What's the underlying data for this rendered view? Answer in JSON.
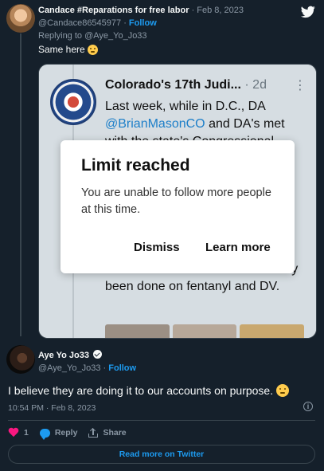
{
  "reply_tweet": {
    "author_name": "Candace #Reparations for free labor",
    "time_sep": " · ",
    "date": "Feb 8, 2023",
    "handle": "@Candace86545977",
    "follow_sep": " · ",
    "follow_label": "Follow",
    "replying_to": "Replying to @Aye_Yo_Jo33",
    "text": "Same here"
  },
  "embedded_screenshot": {
    "account_name": "Colorado's 17th Judi...",
    "age": "2d",
    "text_line1": "Last week, while in D.C., DA",
    "text_mention": "@BrianMasonCO",
    "text_line2": " and DA's met",
    "text_line3": "with the state's Congressional",
    "text_bottom": "also touted the work that's already been done on fentanyl and DV.",
    "dialog": {
      "title": "Limit reached",
      "body": "You are unable to follow more people at this time.",
      "dismiss_label": "Dismiss",
      "learn_more_label": "Learn more"
    }
  },
  "main_tweet": {
    "author_name": "Aye Yo Jo33",
    "handle": "@Aye_Yo_Jo33",
    "follow_sep": " · ",
    "follow_label": "Follow",
    "text": "I believe they are doing it to our accounts on purpose.",
    "timestamp": "10:54 PM · Feb 8, 2023",
    "like_count": "1",
    "reply_label": "Reply",
    "share_label": "Share",
    "read_more_label": "Read more on Twitter"
  },
  "icons": {
    "logo": "twitter-bird-icon",
    "like": "heart-icon",
    "reply": "chat-bubble-icon",
    "share": "share-icon",
    "info": "info-icon",
    "verified": "verified-badge-icon",
    "emoji": "thinking-face-emoji"
  },
  "colors": {
    "background": "#15202b",
    "accent": "#1d9bf0",
    "like": "#f91880",
    "muted": "#8b98a5",
    "border": "#38444d"
  }
}
